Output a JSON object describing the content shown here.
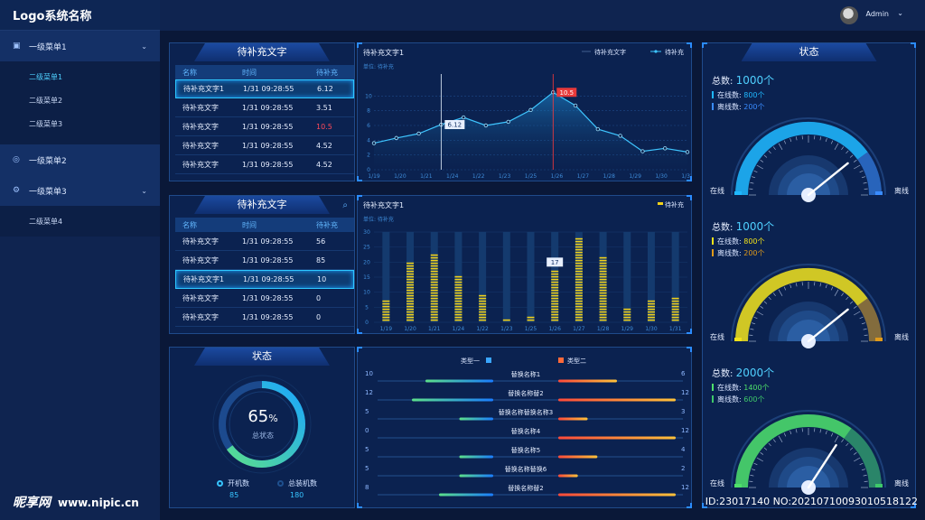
{
  "app": {
    "logo": "Logo系统名称",
    "user": "Admin"
  },
  "sidebar": {
    "menus": [
      {
        "label": "一级菜单1",
        "icon": "chart-icon",
        "subs": [
          "二级菜单1",
          "二级菜单2",
          "二级菜单3"
        ],
        "active_sub": 0
      },
      {
        "label": "一级菜单2",
        "icon": "link-icon",
        "subs": []
      },
      {
        "label": "一级菜单3",
        "icon": "gear-icon",
        "subs": [
          "二级菜单4"
        ]
      }
    ]
  },
  "table1": {
    "title": "待补充文字",
    "headers": [
      "名称",
      "时间",
      "待补充"
    ],
    "rows": [
      {
        "name": "待补充文字1",
        "time": "1/31 09:28:55",
        "value": "6.12"
      },
      {
        "name": "待补充文字",
        "time": "1/31 09:28:55",
        "value": "3.51"
      },
      {
        "name": "待补充文字",
        "time": "1/31 09:28:55",
        "value": "10.5"
      },
      {
        "name": "待补充文字",
        "time": "1/31 09:28:55",
        "value": "4.52"
      },
      {
        "name": "待补充文字",
        "time": "1/31 09:28:55",
        "value": "4.52"
      }
    ],
    "highlight_row": 0,
    "red_row": 2
  },
  "table2": {
    "title": "待补充文字",
    "headers": [
      "名称",
      "时间",
      "待补充"
    ],
    "rows": [
      {
        "name": "待补充文字",
        "time": "1/31 09:28:55",
        "value": "56"
      },
      {
        "name": "待补充文字",
        "time": "1/31 09:28:55",
        "value": "85"
      },
      {
        "name": "待补充文字1",
        "time": "1/31 09:28:55",
        "value": "10"
      },
      {
        "name": "待补充文字",
        "time": "1/31 09:28:55",
        "value": "0"
      },
      {
        "name": "待补充文字",
        "time": "1/31 09:28:55",
        "value": "0"
      }
    ],
    "highlight_row": 2
  },
  "line_chart": {
    "title": "待补充文字1",
    "unit": "单位: 待补充",
    "legend": [
      "待补充文字",
      "待补充"
    ],
    "tooltip1": "6.12",
    "tooltip2": "10.5"
  },
  "bar_chart": {
    "title": "待补充文字1",
    "unit": "单位: 待补充",
    "legend": "待补充",
    "tooltip": "17"
  },
  "donut": {
    "title": "状态",
    "percent": "65",
    "percent_sign": "%",
    "label": "总状态",
    "legend": [
      {
        "label": "开机数",
        "value": "85"
      },
      {
        "label": "总装机数",
        "value": "180"
      }
    ],
    "fraction": 0.65
  },
  "hbars": {
    "legend": [
      "类型一",
      "类型二"
    ],
    "rows": [
      {
        "name": "替换名称1",
        "left": 10,
        "right": 6
      },
      {
        "name": "替换名称替2",
        "left": 12,
        "right": 12
      },
      {
        "name": "替换名称替换名称3",
        "left": 5,
        "right": 3
      },
      {
        "name": "替换名称4",
        "left": 0,
        "right": 12
      },
      {
        "name": "替换名称5",
        "left": 5,
        "right": 4
      },
      {
        "name": "替换名称替换6",
        "left": 5,
        "right": 2
      },
      {
        "name": "替换名称替2",
        "left": 8,
        "right": 12
      }
    ]
  },
  "status_panel": {
    "title": "状态",
    "gauges": [
      {
        "total_label": "总数:",
        "total": "1000个",
        "online_label": "在线数:",
        "online": "800个",
        "offline_label": "离线数:",
        "offline": "200个",
        "start": "在线",
        "end": "离线",
        "color": "#1fb8ff",
        "level": 0.8
      },
      {
        "total_label": "总数:",
        "total": "1000个",
        "online_label": "在线数:",
        "online": "800个",
        "offline_label": "离线数:",
        "offline": "200个",
        "start": "在线",
        "end": "离线",
        "color": "#f2e21a",
        "level": 0.8
      },
      {
        "total_label": "总数:",
        "total": "2000个",
        "online_label": "在线数:",
        "online": "1400个",
        "offline_label": "离线数:",
        "offline": "600个",
        "start": "在线",
        "end": "离线",
        "color": "#4ee06a",
        "level": 0.7
      }
    ]
  },
  "watermark": {
    "brand": "昵享网",
    "domain": "www.nipic.cn",
    "id": "ID:23017140 NO:20210710093010518122"
  },
  "chart_data": [
    {
      "type": "line",
      "categories": [
        "1/19",
        "1/20",
        "1/21",
        "1/24",
        "1/22",
        "1/23",
        "1/25",
        "1/26",
        "1/27",
        "1/28",
        "1/29",
        "1/30",
        "1/31"
      ],
      "values": [
        3.6,
        4.3,
        4.9,
        6.12,
        7.1,
        6.0,
        6.5,
        8.1,
        10.5,
        8.7,
        5.5,
        4.6,
        2.5,
        2.9,
        2.4
      ],
      "ylim": [
        0,
        12
      ],
      "yticks": [
        0,
        2,
        4,
        6,
        8,
        10
      ]
    },
    {
      "type": "bar",
      "categories": [
        "1/19",
        "1/20",
        "1/21",
        "1/24",
        "1/22",
        "1/23",
        "1/25",
        "1/26",
        "1/27",
        "1/28",
        "1/29",
        "1/30",
        "1/31"
      ],
      "values": [
        7,
        20,
        23,
        15,
        9,
        1,
        2,
        17,
        28,
        22,
        5,
        7,
        8
      ],
      "ylim": [
        0,
        30
      ],
      "yticks": [
        0,
        5,
        10,
        15,
        20,
        25,
        30
      ]
    }
  ]
}
